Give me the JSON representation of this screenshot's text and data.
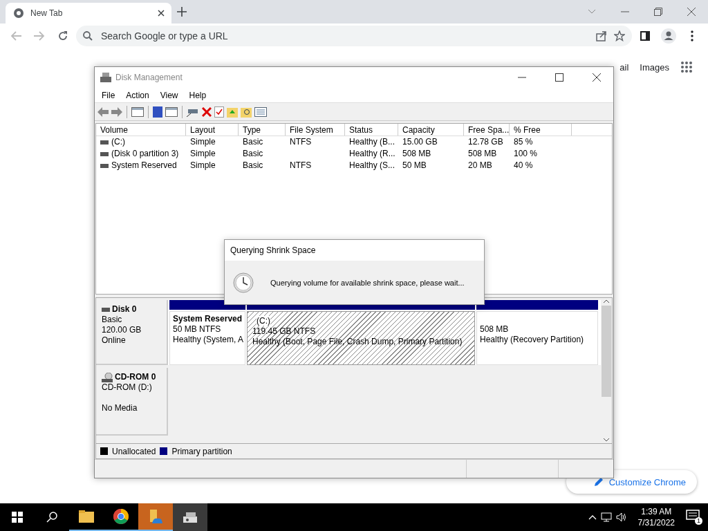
{
  "browser": {
    "tabs": [
      {
        "label": "New Tab",
        "selected": true
      }
    ],
    "omnibox": {
      "placeholder": "Search Google or type a URL"
    },
    "page_links": [
      "ail",
      "Images"
    ],
    "customize_button": "Customize Chrome"
  },
  "disk_management": {
    "title": "Disk Management",
    "menu": [
      "File",
      "Action",
      "View",
      "Help"
    ],
    "columns": [
      "Volume",
      "Layout",
      "Type",
      "File System",
      "Status",
      "Capacity",
      "Free Spa...",
      "% Free"
    ],
    "rows": [
      {
        "cells": [
          "(C:)",
          "Simple",
          "Basic",
          "NTFS",
          "Healthy (B...",
          "15.00 GB",
          "12.78 GB",
          "85 %"
        ]
      },
      {
        "cells": [
          "(Disk 0 partition 3)",
          "Simple",
          "Basic",
          "",
          "Healthy (R...",
          "508 MB",
          "508 MB",
          "100 %"
        ]
      },
      {
        "cells": [
          "System Reserved",
          "Simple",
          "Basic",
          "NTFS",
          "Healthy (S...",
          "50 MB",
          "20 MB",
          "40 %"
        ]
      }
    ],
    "disks": [
      {
        "kind": "disk",
        "name": "Disk 0",
        "lines": [
          "Basic",
          "120.00 GB",
          "Online"
        ],
        "partitions": [
          {
            "name": "System Reserved",
            "size": "50 MB NTFS",
            "status": "Healthy (System, A",
            "selected": false
          },
          {
            "name": "(C:)",
            "size": "119.45 GB NTFS",
            "status": "Healthy (Boot, Page File, Crash Dump, Primary Partition)",
            "selected": true
          },
          {
            "size": "508 MB",
            "status": "Healthy (Recovery Partition)",
            "selected": false
          }
        ]
      },
      {
        "kind": "cdrom",
        "name": "CD-ROM 0",
        "lines": [
          "CD-ROM (D:)",
          "No Media"
        ]
      }
    ],
    "legend": [
      {
        "label": "Unallocated",
        "color": "#000000"
      },
      {
        "label": "Primary partition",
        "color": "#000080"
      }
    ],
    "dialog": {
      "title": "Querying Shrink Space",
      "message": "Querying volume for available shrink space, please wait..."
    }
  },
  "taskbar": {
    "apps": [
      {
        "kind": "folder",
        "selected": false
      },
      {
        "kind": "chrome",
        "selected": false
      },
      {
        "kind": "explorer",
        "selected": true
      },
      {
        "kind": "diskmgmt",
        "selected": false
      }
    ],
    "time": "1:39 AM",
    "date": "7/31/2022",
    "notifications": "1"
  }
}
